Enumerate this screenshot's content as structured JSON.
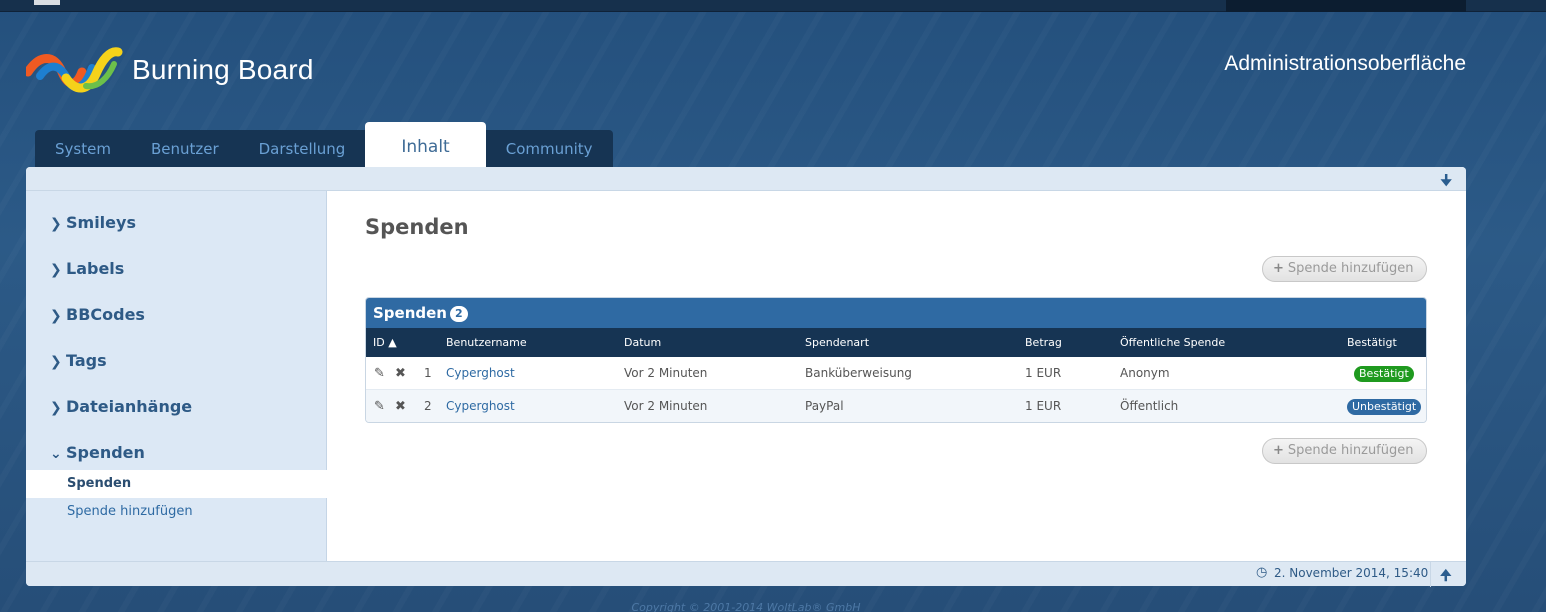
{
  "header": {
    "brand": "Burning Board",
    "admin_title": "Administrationsoberfläche"
  },
  "nav": {
    "tabs": [
      {
        "label": "System"
      },
      {
        "label": "Benutzer"
      },
      {
        "label": "Darstellung"
      },
      {
        "label": "Inhalt"
      },
      {
        "label": "Community"
      }
    ],
    "active": "Inhalt"
  },
  "sidebar": {
    "categories": [
      {
        "label": "Smileys",
        "expanded": false
      },
      {
        "label": "Labels",
        "expanded": false
      },
      {
        "label": "BBCodes",
        "expanded": false
      },
      {
        "label": "Tags",
        "expanded": false
      },
      {
        "label": "Dateianhänge",
        "expanded": false
      },
      {
        "label": "Spenden",
        "expanded": true
      }
    ],
    "subitems": [
      {
        "label": "Spenden",
        "active": true
      },
      {
        "label": "Spende hinzufügen",
        "active": false
      }
    ]
  },
  "content": {
    "title": "Spenden",
    "add_button": "Spende hinzufügen",
    "table": {
      "caption": "Spenden",
      "count": "2",
      "columns": [
        "ID",
        "Benutzername",
        "Datum",
        "Spendenart",
        "Betrag",
        "Öffentliche Spende",
        "Bestätigt"
      ],
      "rows": [
        {
          "id": "1",
          "user": "Cyperghost",
          "date": "Vor 2 Minuten",
          "type": "Banküberweisung",
          "amount": "1 EUR",
          "public": "Anonym",
          "status": "Bestätigt",
          "confirmed": true
        },
        {
          "id": "2",
          "user": "Cyperghost",
          "date": "Vor 2 Minuten",
          "type": "PayPal",
          "amount": "1 EUR",
          "public": "Öffentlich",
          "status": "Unbestätigt",
          "confirmed": false
        }
      ]
    }
  },
  "footer": {
    "timestamp": "2. November 2014, 15:40",
    "copyright": "Copyright © 2001-2014 WoltLab® GmbH"
  },
  "colors": {
    "accent": "#2f6aa3",
    "nav_dark": "#163453",
    "confirmed": "#1f9a1f"
  },
  "icons": [
    "user-avatar",
    "chevron-right-icon",
    "chevron-down-icon",
    "plus-icon",
    "pencil-icon",
    "cross-icon",
    "sort-asc-icon",
    "clock-icon",
    "arrow-down-icon",
    "arrow-up-icon"
  ]
}
